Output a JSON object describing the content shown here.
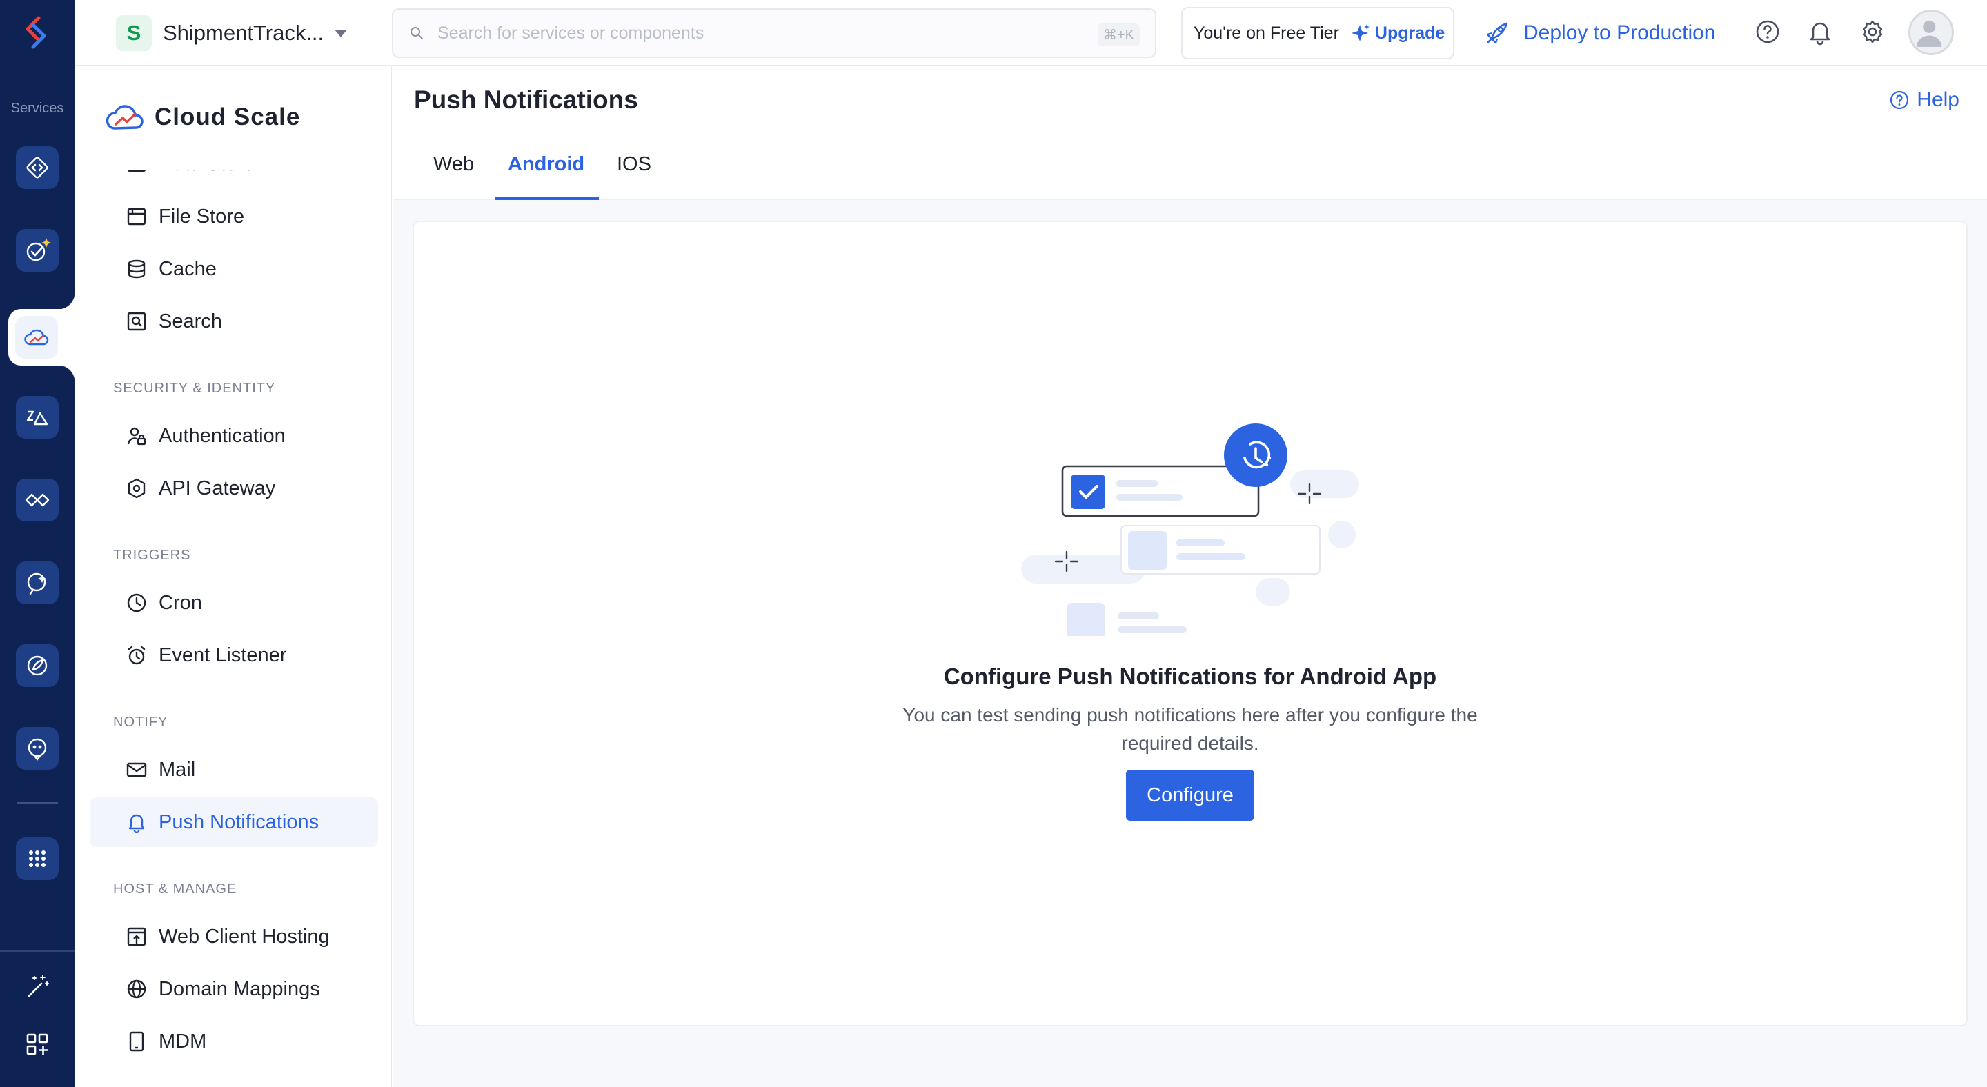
{
  "rail": {
    "section_label": "Services",
    "items": [
      {
        "icon": "code-brackets-icon"
      },
      {
        "icon": "check-sparkle-icon"
      },
      {
        "icon": "cloud-scale-icon",
        "active": true
      },
      {
        "icon": "mountains-icon"
      },
      {
        "icon": "handshake-icon"
      },
      {
        "icon": "sparkle-chat-icon"
      },
      {
        "icon": "rocket-icon"
      },
      {
        "icon": "bot-icon"
      },
      {
        "icon": "apps-grid-icon"
      }
    ],
    "tools": [
      {
        "icon": "magic-wand-icon"
      },
      {
        "icon": "add-widget-icon"
      }
    ]
  },
  "header": {
    "project_initial": "S",
    "project_name": "ShipmentTrack...",
    "search_placeholder": "Search for services or components",
    "search_shortcut": "⌘+K",
    "tier_text": "You're on Free Tier",
    "upgrade_label": "Upgrade",
    "deploy_label": "Deploy to Production"
  },
  "sidebar": {
    "title": "Cloud Scale",
    "items_top": [
      {
        "label": "Data Store",
        "icon": "data-store-icon"
      },
      {
        "label": "File Store",
        "icon": "file-store-icon"
      },
      {
        "label": "Cache",
        "icon": "cache-icon"
      },
      {
        "label": "Search",
        "icon": "search-doc-icon"
      }
    ],
    "sections": [
      {
        "title": "SECURITY & IDENTITY",
        "items": [
          {
            "label": "Authentication",
            "icon": "user-lock-icon"
          },
          {
            "label": "API Gateway",
            "icon": "gateway-icon"
          }
        ]
      },
      {
        "title": "TRIGGERS",
        "items": [
          {
            "label": "Cron",
            "icon": "clock-icon"
          },
          {
            "label": "Event Listener",
            "icon": "alarm-icon"
          }
        ]
      },
      {
        "title": "NOTIFY",
        "items": [
          {
            "label": "Mail",
            "icon": "mail-icon"
          },
          {
            "label": "Push Notifications",
            "icon": "bell-icon",
            "active": true
          }
        ]
      },
      {
        "title": "HOST & MANAGE",
        "items": [
          {
            "label": "Web Client Hosting",
            "icon": "upload-window-icon"
          },
          {
            "label": "Domain Mappings",
            "icon": "globe-icon"
          },
          {
            "label": "MDM",
            "icon": "tablet-icon"
          }
        ]
      }
    ]
  },
  "main": {
    "title": "Push Notifications",
    "help_label": "Help",
    "tabs": [
      "Web",
      "Android",
      "IOS"
    ],
    "active_tab": "Android",
    "empty_title": "Configure Push Notifications for Android App",
    "empty_desc": "You can test sending push notifications here after you configure the required details.",
    "configure_label": "Configure"
  },
  "colors": {
    "accent": "#2b63e0",
    "rail_bg": "#0e2353",
    "rail_btn": "#1e3f86"
  }
}
